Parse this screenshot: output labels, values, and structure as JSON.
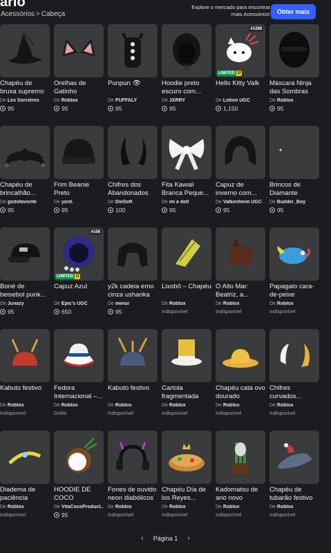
{
  "header": {
    "title": "ario",
    "breadcrumb": [
      "Acessórios",
      "Cabeça"
    ],
    "breadcrumb_separator": ">",
    "promo_text": "Explore o mercado para encontrar mais Acessórios!",
    "cta_label": "Obter mais"
  },
  "price_prefix": "De",
  "items": [
    {
      "name": "Chapéu de bruxa supremo",
      "creator": "Les Sorcières",
      "price": "95",
      "icon": "witch-hat"
    },
    {
      "name": "Orelhas de Gatinho",
      "creator": "Roblox",
      "price": "95",
      "icon": "cat-ears"
    },
    {
      "name": "Punpun",
      "creator": "PUFFALY",
      "price": "95",
      "icon": "punpun",
      "name_suffix": "👁"
    },
    {
      "name": "Hoodie preto escuro com...",
      "creator": "JXRRY",
      "price": "95",
      "icon": "hoodie"
    },
    {
      "name": "Hello Kitty Valk",
      "creator": "Lotion UGC",
      "price": "1,150",
      "icon": "hello-kitty",
      "limited": true,
      "count": "#1288"
    },
    {
      "name": "Máscara Ninja das Sombras",
      "creator": "Roblox",
      "price": "95",
      "icon": "ninja-mask"
    },
    {
      "name": "Chapéu de brincalhão...",
      "creator": "godsfavorite",
      "price": "95",
      "icon": "jester-hat"
    },
    {
      "name": "Frim Beanie Preto",
      "creator": "yord.",
      "price": "95",
      "icon": "beanie"
    },
    {
      "name": "Chifres dos Abandonados",
      "creator": "DieSoft",
      "price": "100",
      "icon": "horns"
    },
    {
      "name": "Fita Kawaii Branca Peque...",
      "creator": "im a doll",
      "price": "95",
      "icon": "bow"
    },
    {
      "name": "Capuz de inverno com...",
      "creator": "Valkenheim UGC",
      "price": "95",
      "icon": "winter-hood"
    },
    {
      "name": "Brincos de Diamante",
      "creator": "Builder_Boy",
      "price": "95",
      "icon": "diamond-earrings"
    },
    {
      "name": "Boné de beisebol punk...",
      "creator": "Junazy",
      "price": "95",
      "icon": "cap"
    },
    {
      "name": "Capuz Azul",
      "creator": "Epic's UGC",
      "price": "650",
      "icon": "blue-hood",
      "limited": true,
      "count": "#106"
    },
    {
      "name": "y2k cadeia emo cinza ushanka",
      "creator": "ewnui",
      "price": "95",
      "icon": "ushanka"
    },
    {
      "name": "Lixobô – Chapéu",
      "creator": "Roblox",
      "status": "Indisponível",
      "icon": "lixobo-hat"
    },
    {
      "name": "O Alto Mar: Beatriz, a...",
      "creator": "Roblox",
      "status": "Indisponível",
      "icon": "sea-hat"
    },
    {
      "name": "Papagaio cara-de-peixe",
      "creator": "Roblox",
      "status": "Indisponível",
      "icon": "fish"
    },
    {
      "name": "Kabuto festivo",
      "creator": "Roblox",
      "status": "Indisponível",
      "icon": "kabuto-red"
    },
    {
      "name": "Fedora Internacional –...",
      "creator": "Roblox",
      "status": "Grátis",
      "icon": "fedora"
    },
    {
      "name": "Kabuto festivo",
      "creator": "Roblox",
      "status": "Indisponível",
      "icon": "kabuto-gold"
    },
    {
      "name": "Cartola fragmentada",
      "creator": "Roblox",
      "status": "Indisponível",
      "icon": "top-hat"
    },
    {
      "name": "Chapéu cata ovo dourado",
      "creator": "Roblox",
      "status": "Indisponível",
      "icon": "gold-hat"
    },
    {
      "name": "Chifres curvados...",
      "creator": "Roblox",
      "status": "Indisponível",
      "icon": "curved-horns"
    },
    {
      "name": "Diadema de paciência",
      "creator": "Roblox",
      "status": "Indisponível",
      "icon": "diadem"
    },
    {
      "name": "HOODIE DE COCO",
      "creator": "VitaCocoProduct...",
      "price": "95",
      "icon": "coconut"
    },
    {
      "name": "Fones de ouvido neon diabólicos",
      "creator": "Roblox",
      "status": "Indisponível",
      "icon": "headphones"
    },
    {
      "name": "Chapéu Día de los Reyes...",
      "creator": "Roblox",
      "status": "Indisponível",
      "icon": "cake-hat"
    },
    {
      "name": "Kadomatsu de ano novo",
      "creator": "Roblox",
      "status": "Indisponível",
      "icon": "kadomatsu"
    },
    {
      "name": "Chapéu de tubarão festivo",
      "creator": "Roblox",
      "status": "Indisponível",
      "icon": "shark-hat"
    }
  ],
  "pagination": {
    "label": "Página 1",
    "prev_icon": "chevron-left-icon",
    "next_icon": "chevron-right-icon"
  },
  "colors": {
    "background": "#1b1c1f",
    "card": "#393b3d",
    "accent": "#335fff",
    "limited": "#00a050",
    "limited_u": "#f7c600"
  }
}
